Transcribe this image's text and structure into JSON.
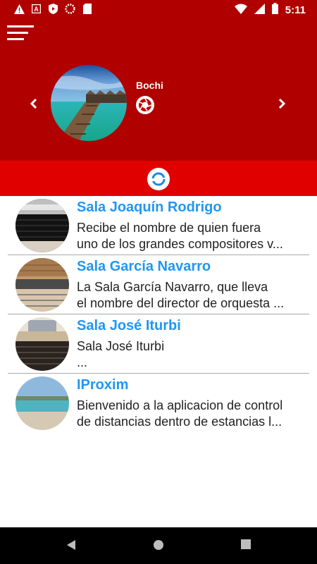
{
  "status_bar": {
    "time": "5:11",
    "icons": [
      "warning-icon",
      "a-box-icon",
      "play-shield-icon",
      "spinner-icon",
      "sd-card-icon",
      "wifi-icon",
      "signal-icon",
      "battery-icon"
    ]
  },
  "header": {
    "menu_icon": "hamburger-icon",
    "user_name": "Bochi",
    "camera_icon": "camera-shutter-icon",
    "prev_icon": "chevron-left-icon",
    "next_icon": "chevron-right-icon",
    "refresh_icon": "refresh-icon"
  },
  "colors": {
    "header_bg": "#b00000",
    "strip_bg": "#e00000",
    "title_blue": "#2196f3"
  },
  "items": [
    {
      "title": "Sala Joaquín Rodrigo",
      "desc_line1": "Recibe el nombre de quien fuera",
      "desc_line2": "uno de los grandes compositores v..."
    },
    {
      "title": "Sala García Navarro",
      "desc_line1": "La Sala García Navarro, que lleva",
      "desc_line2": "el nombre del director de orquesta ..."
    },
    {
      "title": "Sala José Iturbi",
      "desc_line1": "Sala José Iturbi",
      "desc_line2": "..."
    },
    {
      "title": "IProxim",
      "desc_line1": "Bienvenido a la aplicacion de control",
      "desc_line2": "de distancias dentro de estancias l..."
    }
  ],
  "nav_bar": [
    "back-icon",
    "home-icon",
    "recents-icon"
  ]
}
